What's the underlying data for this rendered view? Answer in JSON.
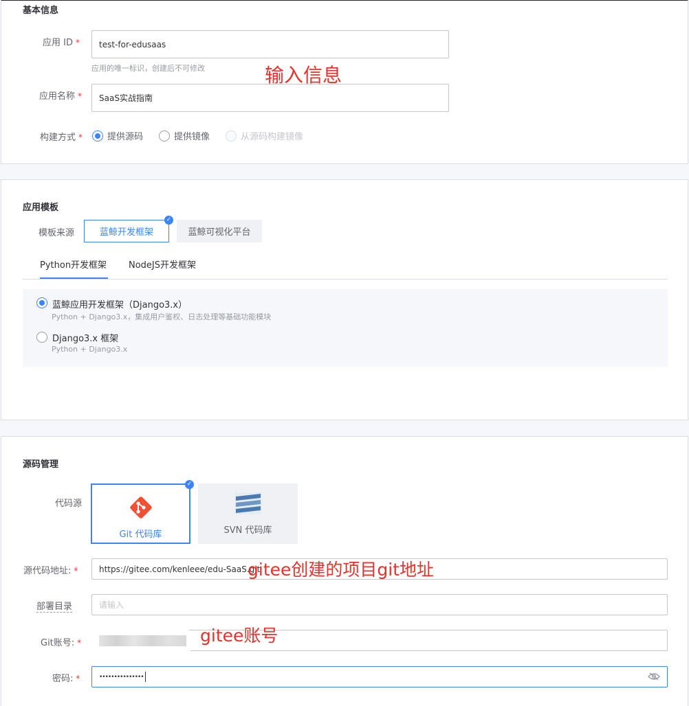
{
  "basic": {
    "title": "基本信息",
    "app_id": {
      "label": "应用 ID",
      "required": "*",
      "value": "test-for-edusaas",
      "hint": "应用的唯一标识，创建后不可修改"
    },
    "app_name": {
      "label": "应用名称",
      "required": "*",
      "value": "SaaS实战指南"
    },
    "build": {
      "label": "构建方式",
      "required": "*",
      "options": [
        {
          "label": "提供源码",
          "checked": true,
          "disabled": false
        },
        {
          "label": "提供镜像",
          "checked": false,
          "disabled": false
        },
        {
          "label": "从源码构建镜像",
          "checked": false,
          "disabled": true
        }
      ]
    },
    "annotation": "输入信息"
  },
  "template": {
    "title": "应用模板",
    "source_label": "模板来源",
    "sources": [
      {
        "label": "蓝鲸开发框架",
        "selected": true
      },
      {
        "label": "蓝鲸可视化平台",
        "selected": false
      }
    ],
    "tabs": [
      {
        "label": "Python开发框架",
        "active": true
      },
      {
        "label": "NodeJS开发框架",
        "active": false
      }
    ],
    "frameworks": [
      {
        "name": "蓝鲸应用开发框架（Django3.x）",
        "desc": "Python + Django3.x，集成用户鉴权、日志处理等基础功能模块",
        "checked": true
      },
      {
        "name": "Django3.x 框架",
        "desc": "Python + Django3.x",
        "checked": false
      }
    ]
  },
  "source": {
    "title": "源码管理",
    "repo_label": "代码源",
    "repos": [
      {
        "label": "Git 代码库",
        "icon": "git-icon",
        "selected": true
      },
      {
        "label": "SVN 代码库",
        "icon": "subversion-icon",
        "selected": false
      }
    ],
    "repo_url": {
      "label": "源代码地址:",
      "required": "*",
      "value": "https://gitee.com/kenleee/edu-SaaS.git"
    },
    "deploy_dir": {
      "label": "部署目录",
      "placeholder": "请输入"
    },
    "git_account": {
      "label": "Git账号:",
      "required": "*"
    },
    "password": {
      "label": "密码:",
      "required": "*",
      "value": "•••••••••••••••"
    },
    "annotation_url": "gitee创建的项目git地址",
    "annotation_account": "gitee账号",
    "colors": {
      "accent": "#3a84ff",
      "annotation": "#e8312a",
      "required": "#ea3636"
    }
  }
}
